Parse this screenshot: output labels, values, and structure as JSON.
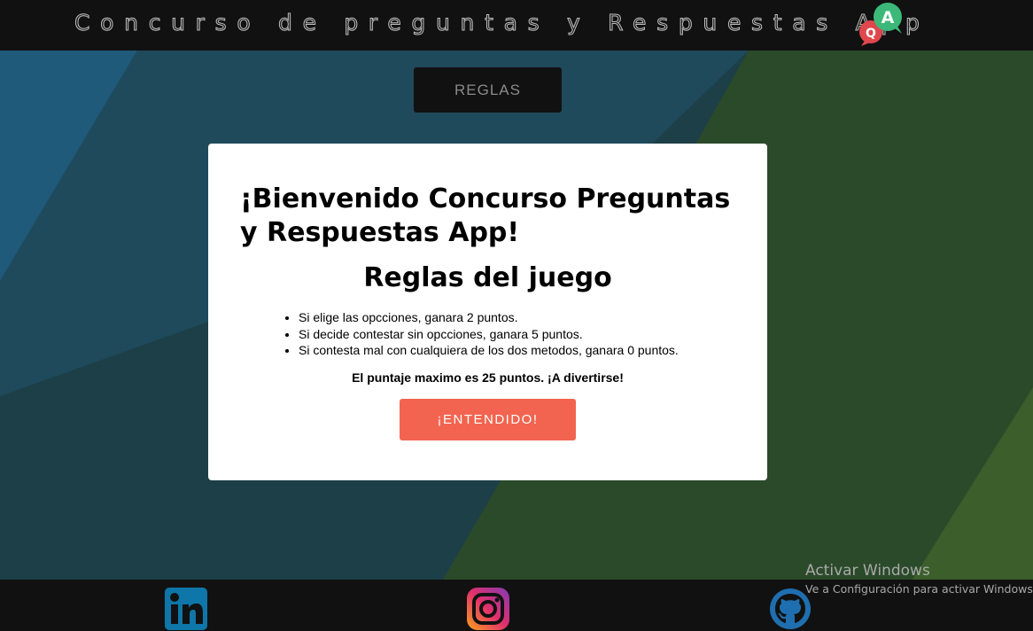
{
  "header": {
    "title": "Concurso de preguntas y Respuestas App",
    "logo_letters": {
      "q": "Q",
      "a": "A"
    }
  },
  "reglas_button": {
    "label": "REGLAS"
  },
  "modal": {
    "welcome": "¡Bienvenido Concurso Preguntas y Respuestas App!",
    "subtitle": "Reglas del juego",
    "rules": [
      "Si elige las opcciones, ganara 2 puntos.",
      "Si decide contestar sin opcciones, ganara 5 puntos.",
      "Si contesta mal con cualquiera de los dos metodos, ganara 0 puntos."
    ],
    "max_points": "El puntaje maximo es 25 puntos. ¡A divertirse!",
    "ok_button": "¡ENTENDIDO!"
  },
  "footer": {
    "icons": [
      "linkedin-icon",
      "instagram-icon",
      "github-icon"
    ]
  },
  "windows_watermark": {
    "title": "Activar Windows",
    "subtitle": "Ve a Configuración para activar Windows."
  },
  "colors": {
    "background_teal": "#1d3f47",
    "background_blue": "#1f5a7a",
    "background_green": "#2a4a2a",
    "bar": "#111111",
    "accent_button": "#f2644f",
    "logo_red": "#e0474c",
    "logo_green": "#3cb878"
  }
}
